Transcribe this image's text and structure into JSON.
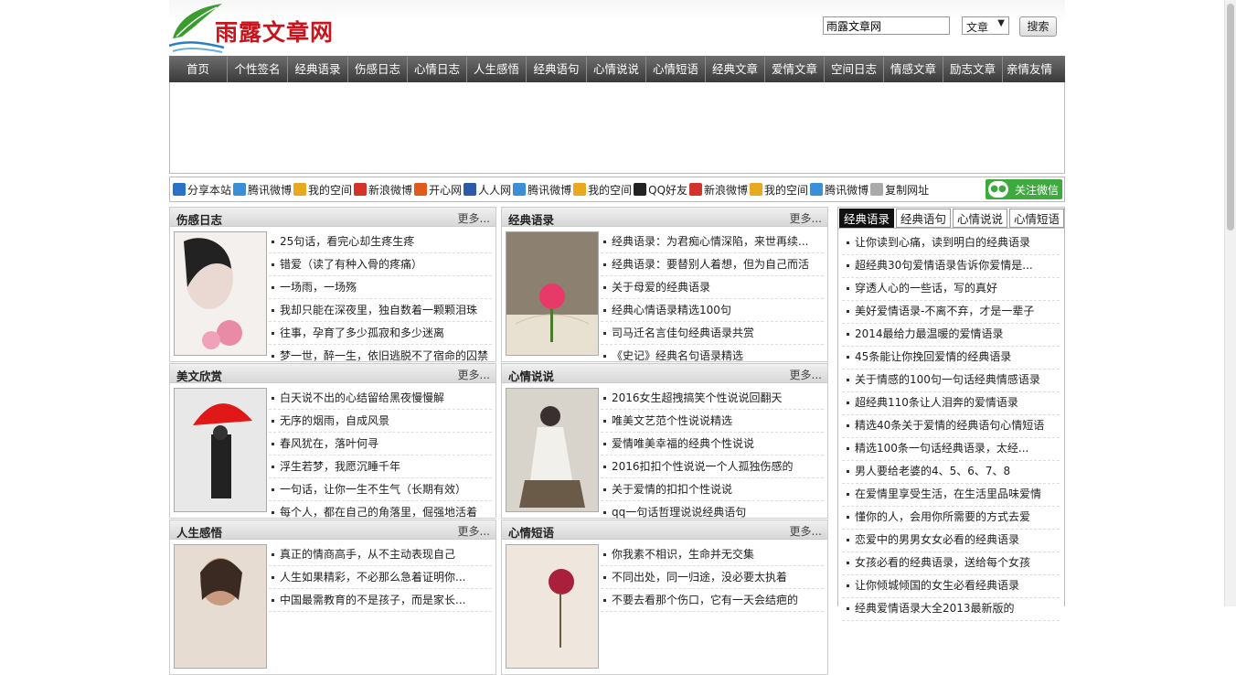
{
  "header": {
    "logo_text": "雨露文章网",
    "search_value": "雨露文章网",
    "search_type": "文章",
    "search_button": "搜索"
  },
  "nav": [
    "首页",
    "个性签名",
    "经典语录",
    "伤感日志",
    "心情日志",
    "人生感悟",
    "经典语句",
    "心情说说",
    "心情短语",
    "经典文章",
    "爱情文章",
    "空间日志",
    "情感文章",
    "励志文章",
    "亲情友情"
  ],
  "share": {
    "items": [
      {
        "label": "分享本站",
        "icon": "plus-icon",
        "color": "#2a72c8"
      },
      {
        "label": "腾讯微博",
        "icon": "tencent-weibo-icon",
        "color": "#3b8fd6"
      },
      {
        "label": "我的空间",
        "icon": "qzone-icon",
        "color": "#e8a820"
      },
      {
        "label": "新浪微博",
        "icon": "sina-weibo-icon",
        "color": "#d2342c"
      },
      {
        "label": "开心网",
        "icon": "kaixin-icon",
        "color": "#e05a1c"
      },
      {
        "label": "人人网",
        "icon": "renren-icon",
        "color": "#2a5aa8"
      },
      {
        "label": "腾讯微博",
        "icon": "tencent-weibo-icon",
        "color": "#3b8fd6"
      },
      {
        "label": "我的空间",
        "icon": "qzone-icon",
        "color": "#e8a820"
      },
      {
        "label": "QQ好友",
        "icon": "qq-icon",
        "color": "#222222"
      },
      {
        "label": "新浪微博",
        "icon": "sina-weibo-icon",
        "color": "#d2342c"
      },
      {
        "label": "我的空间",
        "icon": "qzone-icon",
        "color": "#e8a820"
      },
      {
        "label": "腾讯微博",
        "icon": "tencent-weibo-icon",
        "color": "#3b8fd6"
      },
      {
        "label": "复制网址",
        "icon": "copy-icon",
        "color": "#aaaaaa"
      }
    ],
    "wechat_label": "关注微信"
  },
  "panels": [
    {
      "title": "伤感日志",
      "more": "更多...",
      "items": [
        "25句话，看完心却生疼生疼",
        "错爱（读了有种入骨的疼痛）",
        "一场雨，一场殇",
        "我却只能在深夜里，独自数着一颗颗泪珠",
        "往事，孕育了多少孤寂和多少迷离",
        "梦一世，醉一生，依旧逃脱不了宿命的囚禁"
      ]
    },
    {
      "title": "经典语录",
      "more": "更多...",
      "items": [
        "经典语录：为君痴心情深陷，来世再续...",
        "经典语录：要替别人着想，但为自己而活",
        "关于母爱的经典语录",
        "经典心情语录精选100句",
        "司马迁名言佳句经典语录共赏",
        "《史记》经典名句语录精选"
      ]
    },
    {
      "title": "美文欣赏",
      "more": "更多...",
      "items": [
        "白天说不出的心结留给黑夜慢慢解",
        "无序的烟雨，自成风景",
        "春风犹在，落叶何寻",
        "浮生若梦，我愿沉睡千年",
        "一句话，让你一生不生气（长期有效）",
        "每个人，都在自己的角落里，倔强地活着"
      ]
    },
    {
      "title": "心情说说",
      "more": "更多...",
      "items": [
        "2016女生超拽搞笑个性说说回翻天",
        "唯美文艺范个性说说精选",
        "爱情唯美幸福的经典个性说说",
        "2016扣扣个性说说一个人孤独伤感的",
        "关于爱情的扣扣个性说说",
        "qq一句话哲理说说经典语句"
      ]
    },
    {
      "title": "人生感悟",
      "more": "更多...",
      "items": [
        "真正的情商高手，从不主动表现自己",
        "人生如果精彩，不必那么急着证明你...",
        "中国最需教育的不是孩子，而是家长...",
        "",
        "",
        ""
      ]
    },
    {
      "title": "心情短语",
      "more": "更多...",
      "items": [
        "你我素不相识，生命并无交集",
        "不同出处，同一归途，没必要太执着",
        "不要去看那个伤口，它有一天会结疤的",
        "",
        "",
        ""
      ]
    }
  ],
  "right": {
    "tabs": [
      "经典语录",
      "经典语句",
      "心情说说",
      "心情短语"
    ],
    "items": [
      "让你读到心痛，读到明白的经典语录",
      "超经典30句爱情语录告诉你爱情是...",
      "穿透人心的一些话，写的真好",
      "美好爱情语录-不离不弃，才是一辈子",
      "2014最给力最温暖的爱情语录",
      "45条能让你挽回爱情的经典语录",
      "关于情感的100句一句话经典情感语录",
      "超经典110条让人泪奔的爱情语录",
      "精选40条关于爱情的经典语句心情短语",
      "精选100条一句话经典语录，太经...",
      "男人要给老婆的4、5、6、7、8",
      "在爱情里享受生活，在生活里品味爱情",
      "懂你的人，会用你所需要的方式去爱",
      "恋爱中的男男女女必看的经典语录",
      "女孩必看的经典语录，送给每个女孩",
      "让你倾城倾国的女生必看经典语录",
      "经典爱情语录大全2013最新版的"
    ]
  }
}
